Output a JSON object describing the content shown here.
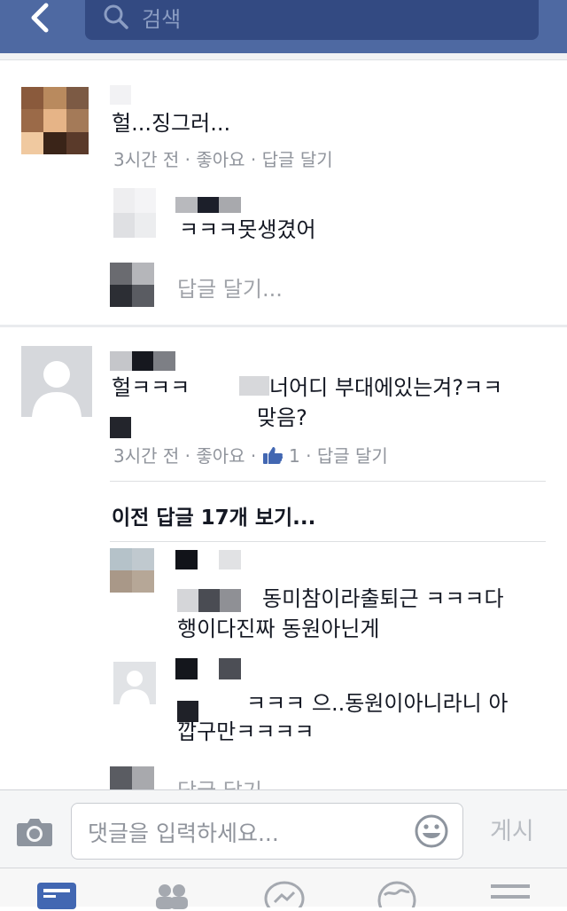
{
  "header": {
    "search_placeholder": "검색"
  },
  "post1": {
    "comment": "헐...징그러...",
    "time": "3시간 전",
    "like": "좋아요",
    "reply": "답글 달기",
    "reply1_text": "ㅋㅋㅋ못생겼어",
    "reply_placeholder": "답글 달기..."
  },
  "post2": {
    "comment_line1_a": "헐ㅋㅋㅋ",
    "comment_line1_b": "너어디 부대에있는겨?ㅋㅋ",
    "comment_line2": "맞음?",
    "time": "3시간 전",
    "like": "좋아요",
    "like_count": "1",
    "reply": "답글 달기",
    "more_replies": "이전 답글 17개 보기...",
    "reply1_line1": "동미참이라출퇴근 ㅋㅋㅋ다",
    "reply1_line2": "행이다진짜 동원아닌게",
    "reply2_line1": "ㅋㅋㅋ 으..동원이아니라니 아",
    "reply2_line2": "깝구만ㅋㅋㅋㅋ",
    "reply_placeholder": "답글 달기"
  },
  "composer": {
    "placeholder": "댓글을 입력하세요...",
    "post_label": "게시"
  },
  "colors": {
    "header": "#4e69a2",
    "like_blue": "#4267b2"
  }
}
